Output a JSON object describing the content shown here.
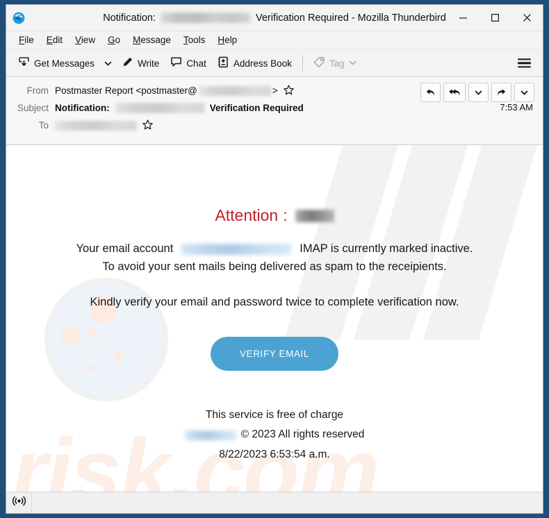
{
  "window": {
    "title_prefix": "Notification:",
    "title_redacted": "",
    "title_suffix": "Verification Required - Mozilla Thunderbird",
    "app_icon": "thunderbird-icon",
    "minimize_label": "─",
    "maximize_label": "□",
    "close_label": "✕"
  },
  "menubar": {
    "items": [
      {
        "accel": "F",
        "rest": "ile"
      },
      {
        "accel": "E",
        "rest": "dit"
      },
      {
        "accel": "V",
        "rest": "iew"
      },
      {
        "accel": "G",
        "rest": "o"
      },
      {
        "accel": "M",
        "rest": "essage"
      },
      {
        "accel": "T",
        "rest": "ools"
      },
      {
        "accel": "H",
        "rest": "elp"
      }
    ]
  },
  "toolbar": {
    "get_messages_label": "Get Messages",
    "write_label": "Write",
    "chat_label": "Chat",
    "address_book_label": "Address Book",
    "tag_label": "Tag",
    "tag_disabled": true,
    "app_menu_name": "hamburger-menu"
  },
  "message_header": {
    "from_label": "From",
    "from_display_name": "Postmaster Report",
    "from_address_prefix": "<postmaster@",
    "from_address_suffix": ">",
    "subject_label": "Subject",
    "subject_prefix": "Notification:",
    "subject_suffix": "Verification Required",
    "to_label": "To",
    "time": "7:53 AM",
    "actions": [
      {
        "name": "reply-button",
        "glyph": "↩"
      },
      {
        "name": "reply-all-button",
        "glyph": "↩↩"
      },
      {
        "name": "reply-options-chevron",
        "glyph": "⌄"
      },
      {
        "name": "forward-button",
        "glyph": "↪"
      },
      {
        "name": "more-actions-chevron",
        "glyph": "⌄"
      }
    ]
  },
  "email": {
    "attention_label": "Attention",
    "attention_separator": ":",
    "line1_before": "Your email account",
    "line1_after": "IMAP is currently marked inactive.",
    "line2": "To avoid your sent mails being delivered as spam to the receipients.",
    "line3": "Kindly verify your email and password twice to complete verification now.",
    "cta_label": "VERIFY EMAIL",
    "footer_service": "This service is free of charge",
    "footer_copyright": "© 2023 All rights reserved",
    "footer_timestamp": "8/22/2023 6:53:54 a.m.",
    "watermark_text": "risk.com",
    "accent_red": "#bf2027",
    "cta_blue": "#4ba3d3",
    "watermark_pink": "#fdeee6"
  },
  "statusbar": {
    "online_icon": "broadcast-online-icon"
  }
}
